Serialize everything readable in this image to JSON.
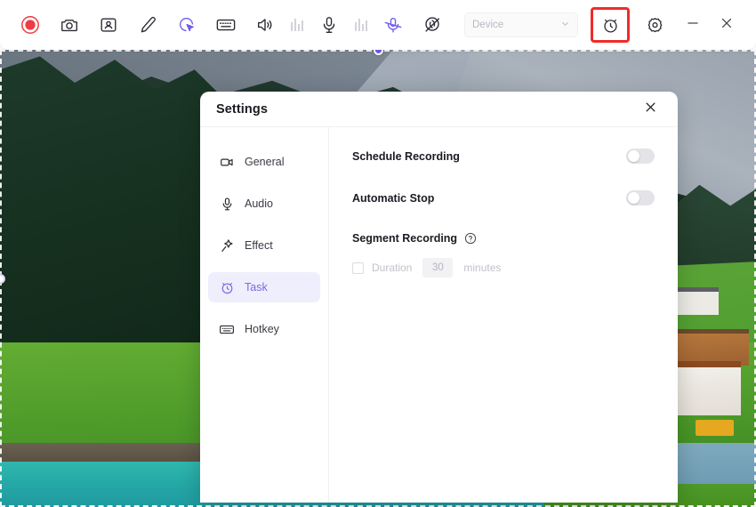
{
  "toolbar": {
    "buttons": [
      {
        "name": "record-button",
        "icon": "record-icon",
        "label": "Record"
      },
      {
        "name": "screenshot-button",
        "icon": "camera-icon",
        "label": "Screenshot"
      },
      {
        "name": "webcam-button",
        "icon": "person-frame-icon",
        "label": "Webcam"
      },
      {
        "name": "draw-button",
        "icon": "pencil-icon",
        "label": "Draw"
      },
      {
        "name": "cursor-button",
        "icon": "cursor-highlight-icon",
        "label": "Cursor"
      },
      {
        "name": "keystroke-button",
        "icon": "keyboard-icon",
        "label": "Keystrokes"
      },
      {
        "name": "speaker-button",
        "icon": "speaker-icon",
        "label": "System Audio"
      },
      {
        "name": "speaker-meter",
        "icon": "level-meter-icon",
        "label": "Speaker Level"
      },
      {
        "name": "microphone-button",
        "icon": "microphone-icon",
        "label": "Microphone"
      },
      {
        "name": "microphone-meter",
        "icon": "level-meter-icon",
        "label": "Microphone Level"
      },
      {
        "name": "microphone-mute-button",
        "icon": "microphone-muted-icon",
        "label": "Mute Microphone"
      },
      {
        "name": "webcam-off-button",
        "icon": "webcam-off-icon",
        "label": "Webcam Off"
      }
    ],
    "device_select": {
      "value": "Device",
      "caret": "chevron-down-icon"
    },
    "timer_button": {
      "name": "timer-button",
      "icon": "alarm-clock-icon",
      "label": "Task Timer"
    },
    "settings_button": {
      "name": "settings-button",
      "icon": "gear-icon",
      "label": "Settings"
    },
    "minimize_button": {
      "name": "minimize-button",
      "icon": "minimize-icon",
      "label": "Minimize"
    },
    "close_button": {
      "name": "close-button",
      "icon": "close-icon",
      "label": "Close"
    },
    "highlight_color": "#f22a2a"
  },
  "capture": {
    "selection_label": "Recording region selection",
    "handle_color": "#6f5cf0"
  },
  "dialog": {
    "title": "Settings",
    "close_icon": "close-icon",
    "nav": [
      {
        "label": "General",
        "icon": "video-camera-icon",
        "active": false
      },
      {
        "label": "Audio",
        "icon": "microphone-icon",
        "active": false
      },
      {
        "label": "Effect",
        "icon": "magic-wand-icon",
        "active": false
      },
      {
        "label": "Task",
        "icon": "alarm-clock-icon",
        "active": true
      },
      {
        "label": "Hotkey",
        "icon": "keyboard-icon",
        "active": false
      }
    ],
    "task": {
      "schedule_recording": {
        "label": "Schedule Recording",
        "enabled": false
      },
      "automatic_stop": {
        "label": "Automatic Stop",
        "enabled": false
      },
      "segment_recording": {
        "label": "Segment Recording",
        "help_icon": "question-mark-icon",
        "duration": {
          "checked": false,
          "label": "Duration",
          "value": "30",
          "unit": "minutes"
        }
      }
    },
    "active_color": "#7a6ae0",
    "active_bg": "#eeeefc"
  }
}
